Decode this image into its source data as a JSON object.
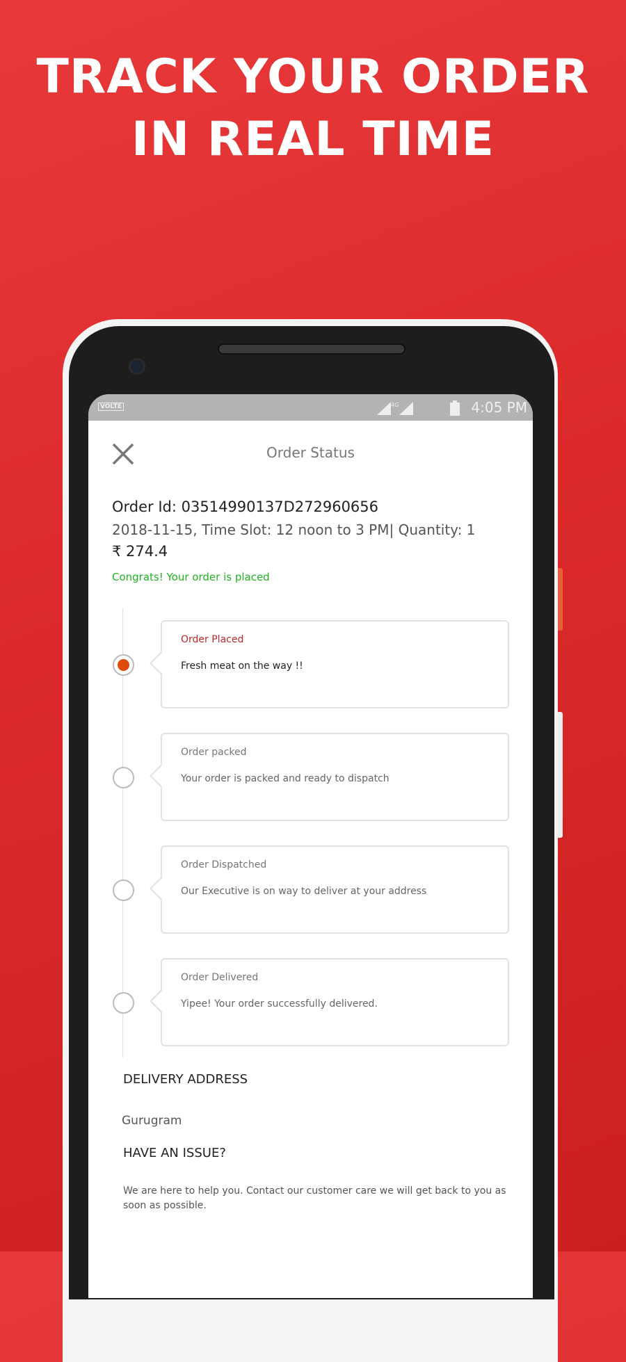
{
  "headline": {
    "line1": "TRACK YOUR ORDER",
    "line2": "IN REAL TIME"
  },
  "status_bar": {
    "carrier_badge": "VOLTE",
    "network": "4G",
    "time": "4:05 PM"
  },
  "header": {
    "title": "Order Status",
    "close_icon": "close-icon"
  },
  "order": {
    "id_text": "Order Id: 03514990137D272960656",
    "details": "2018-11-15, Time Slot: 12 noon to 3 PM| Quantity: 1",
    "price": "₹ 274.4",
    "message": "Congrats! Your order is placed"
  },
  "timeline": [
    {
      "title": "Order Placed",
      "body": "Fresh meat on the way !!",
      "active": true
    },
    {
      "title": "Order packed",
      "body": "Your order is packed and ready to dispatch",
      "active": false
    },
    {
      "title": "Order Dispatched",
      "body": "Our Executive is on way to deliver at your address",
      "active": false
    },
    {
      "title": "Order Delivered",
      "body": "Yipee! Your order successfully delivered.",
      "active": false
    }
  ],
  "delivery": {
    "heading": "DELIVERY ADDRESS",
    "address": "Gurugram"
  },
  "issue": {
    "heading": "HAVE AN ISSUE?",
    "text": "We are here to help you. Contact our customer care we will get back to you as soon as possible."
  },
  "colors": {
    "background": "#dc2a2b",
    "active_title": "#c0282a",
    "active_dot": "#e04a0a",
    "success": "#1fb31f"
  }
}
